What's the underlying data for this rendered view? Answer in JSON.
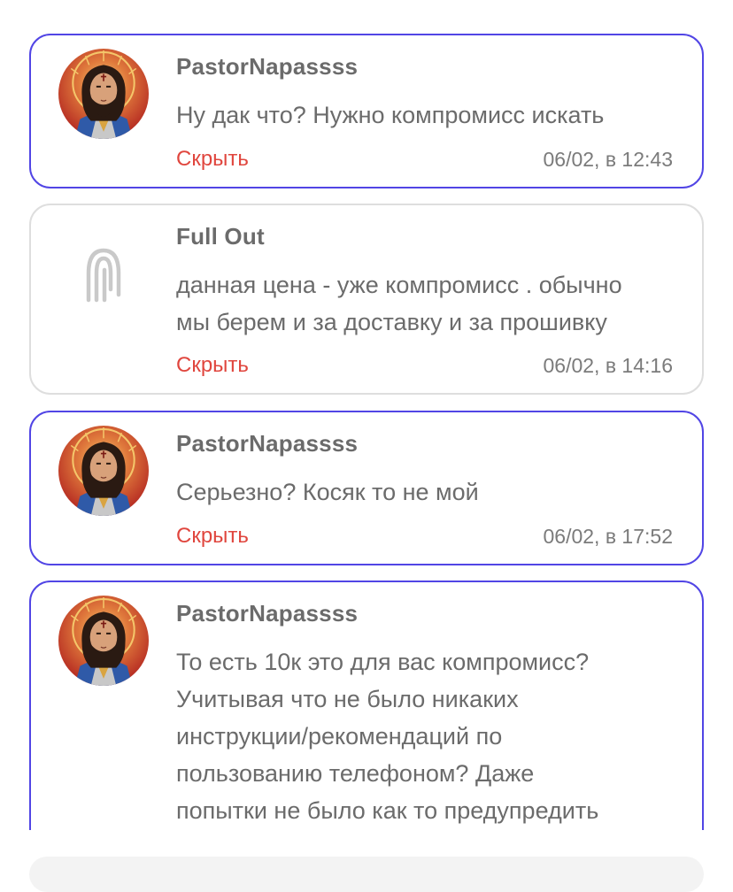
{
  "messages": [
    {
      "author": "PastorNapassss",
      "text": "Ну дак что? Нужно компромисс искать",
      "hide_label": "Скрыть",
      "time": "06/02, в 12:43",
      "avatar_icon": "portrait-avatar"
    },
    {
      "author": "Full Out",
      "text": "данная цена - уже компромисс . обычно\nмы берем и за доставку и за прошивку",
      "hide_label": "Скрыть",
      "time": "06/02, в 14:16",
      "avatar_icon": "brand-logo-icon"
    },
    {
      "author": "PastorNapassss",
      "text": "Серьезно? Косяк то не мой",
      "hide_label": "Скрыть",
      "time": "06/02, в 17:52",
      "avatar_icon": "portrait-avatar"
    },
    {
      "author": "PastorNapassss",
      "text": "То есть 10к это для вас компромисс?\nУчитывая что не было никаких\nинструкции/рекомендаций по\nпользованию телефоном? Даже\nпопытки не было как то предупредить",
      "avatar_icon": "portrait-avatar"
    }
  ],
  "colors": {
    "accent_border": "#5145e5",
    "neutral_border": "#dedede",
    "hide_link": "#e0463e",
    "text": "#6b6b6b"
  }
}
